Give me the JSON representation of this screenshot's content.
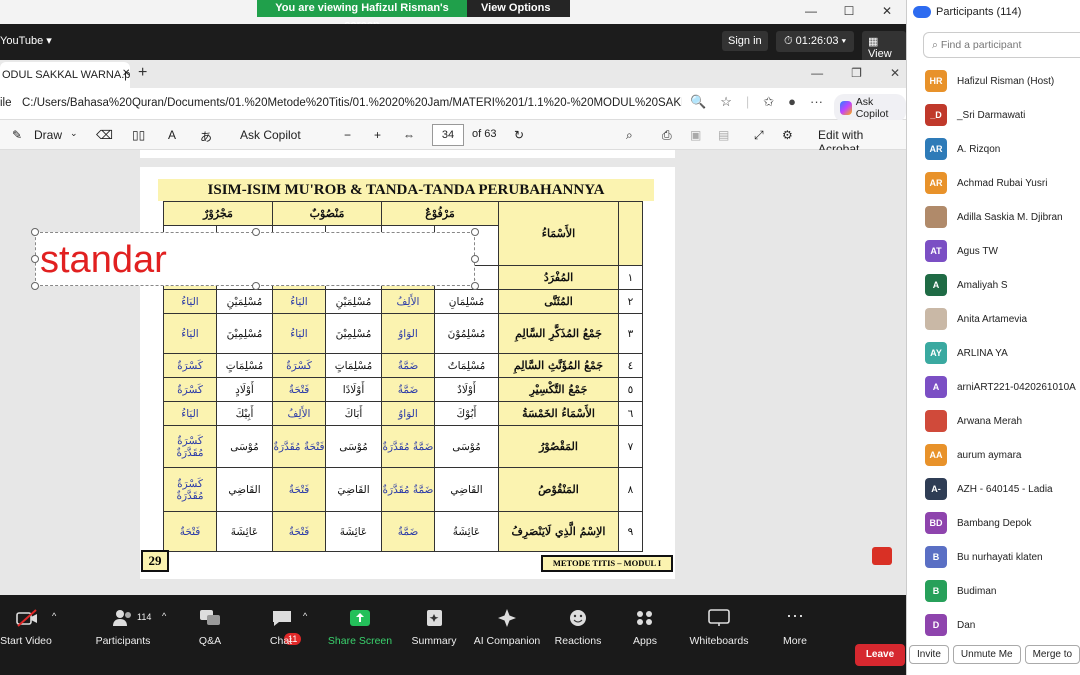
{
  "banner": {
    "message": "You are viewing Hafizul Risman's screen",
    "options": "View Options"
  },
  "zoom_top": {
    "youtube": "YouTube ▾",
    "signin": "Sign in",
    "timer": "01:26:03",
    "view": "View"
  },
  "browser": {
    "tab_title": "ODUL SAKKAL WARNA.pd",
    "url_prefix": "ile",
    "url": "C:/Users/Bahasa%20Quran/Documents/01.%20Metode%20Titis/01.%2020%20Jam/MATERI%201/1.1%20-%20MODUL%20SAKKAL%20...",
    "copilot": "Ask Copilot"
  },
  "pdf_toolbar": {
    "draw": "Draw",
    "ask_copilot": "Ask Copilot",
    "page": "34",
    "of": "of 63",
    "edit": "Edit with Acrobat"
  },
  "page": {
    "title": "ISIM-ISIM MU'ROB & TANDA-TANDA PERUBAHANNYA",
    "page_number": "29",
    "footer": "METODE TITIS – MODUL I",
    "headers": {
      "asma": "الأَسْمَاءُ",
      "marfu": "مَرْفُوْعٌ",
      "manshub": "مَنْصُوْبٌ",
      "majrur": "مَجْرُوْرٌ"
    },
    "rows": [
      {
        "no": "١",
        "name": "المُفْرَدُ",
        "cells": [
          "مُسْ",
          "",
          "",
          "",
          "",
          ""
        ]
      },
      {
        "no": "٢",
        "name": "المُثَنَّى",
        "cells": [
          "مُسْلِمَانِ",
          "الأَلِفُ",
          "مُسْلِمَيْنِ",
          "اليَاءُ",
          "مُسْلِمَيْنِ",
          "اليَاءُ"
        ]
      },
      {
        "no": "٣",
        "name": "جَمْعُ المُذَكَّرِ السَّالِمِ",
        "cells": [
          "مُسْلِمُوْنَ",
          "الوَاوُ",
          "مُسْلِمِيْنَ",
          "اليَاءُ",
          "مُسْلِمِيْنَ",
          "اليَاءُ"
        ]
      },
      {
        "no": "٤",
        "name": "جَمْعُ المُؤَنَّثِ السَّالِمِ",
        "cells": [
          "مُسْلِمَاتٌ",
          "ضَمَّةٌ",
          "مُسْلِمَاتٍ",
          "كَسْرَةٌ",
          "مُسْلِمَاتٍ",
          "كَسْرَةٌ"
        ]
      },
      {
        "no": "٥",
        "name": "جَمْعُ التَّكْسِيْرِ",
        "cells": [
          "أَوْلَادٌ",
          "ضَمَّةٌ",
          "أَوْلَادًا",
          "فَتْحَةٌ",
          "أَوْلَادٍ",
          "كَسْرَةٌ"
        ]
      },
      {
        "no": "٦",
        "name": "الأَسْمَاءُ الخَمْسَةُ",
        "cells": [
          "أَبُوْكَ",
          "الوَاوُ",
          "أَبَاكَ",
          "الأَلِفُ",
          "أَبِيْكَ",
          "اليَاءُ"
        ]
      },
      {
        "no": "٧",
        "name": "المَقْصُوْرُ",
        "cells": [
          "مُوْسَى",
          "ضَمَّةٌ مُقَدَّرَةٌ",
          "مُوْسَى",
          "فَتْحَةٌ مُقَدَّرَةٌ",
          "مُوْسَى",
          "كَسْرَةٌ مُقَدَّرَةٌ"
        ]
      },
      {
        "no": "٨",
        "name": "المَنْقُوْصُ",
        "cells": [
          "القَاضِي",
          "ضَمَّةٌ مُقَدَّرَةٌ",
          "القَاضِيَ",
          "فَتْحَةٌ",
          "القَاضِي",
          "كَسْرَةٌ مُقَدَّرَةٌ"
        ]
      },
      {
        "no": "٩",
        "name": "الاِسْمُ الَّذِي لَايَنْصَرِفُ",
        "cells": [
          "عَائِشَةُ",
          "ضَمَّةٌ",
          "عَائِشَةَ",
          "فَتْحَةٌ",
          "عَائِشَةَ",
          "فَتْحَةٌ"
        ]
      }
    ]
  },
  "annotation": {
    "text": "standar"
  },
  "zoom_bar": {
    "start_video": "Start Video",
    "participants": "Participants",
    "participants_count": "114",
    "qa": "Q&A",
    "chat": "Chat",
    "chat_badge": "11",
    "share": "Share Screen",
    "summary": "Summary",
    "ai": "AI Companion",
    "reactions": "Reactions",
    "apps": "Apps",
    "whiteboards": "Whiteboards",
    "more": "More",
    "leave": "Leave"
  },
  "panel": {
    "title": "Participants (114)",
    "search_placeholder": "Find a participant",
    "participants": [
      {
        "initials": "HR",
        "name": "Hafizul Risman (Host)",
        "color": "#e8922a"
      },
      {
        "initials": "_D",
        "name": "_Sri Darmawati",
        "color": "#c0392b"
      },
      {
        "initials": "AR",
        "name": "A. Rizqon",
        "color": "#2e7bb8"
      },
      {
        "initials": "AR",
        "name": "Achmad Rubai Yusri",
        "color": "#e8922a"
      },
      {
        "initials": "",
        "name": "Adilla Saskia M. Djibran",
        "color": "#b08a6a"
      },
      {
        "initials": "AT",
        "name": "Agus TW",
        "color": "#7b4fc4"
      },
      {
        "initials": "A",
        "name": "Amaliyah S",
        "color": "#1f6b45"
      },
      {
        "initials": "",
        "name": "Anita Artamevia",
        "color": "#c9b8a6"
      },
      {
        "initials": "AY",
        "name": "ARLINA YA",
        "color": "#3aa9a0"
      },
      {
        "initials": "A",
        "name": "arniART221-0420261010A",
        "color": "#7b4fc4"
      },
      {
        "initials": "",
        "name": "Arwana Merah",
        "color": "#d04a3a"
      },
      {
        "initials": "AA",
        "name": "aurum aymara",
        "color": "#e8922a"
      },
      {
        "initials": "A-",
        "name": "AZH - 640145 - Ladia",
        "color": "#2f3d55"
      },
      {
        "initials": "BD",
        "name": "Bambang Depok",
        "color": "#8e44ad"
      },
      {
        "initials": "B",
        "name": "Bu nurhayati klaten",
        "color": "#5a6fc4"
      },
      {
        "initials": "B",
        "name": "Budiman",
        "color": "#27a05a"
      },
      {
        "initials": "D",
        "name": "Dan",
        "color": "#8e44ad"
      }
    ],
    "invite": "Invite",
    "unmute": "Unmute Me",
    "merge": "Merge to"
  }
}
